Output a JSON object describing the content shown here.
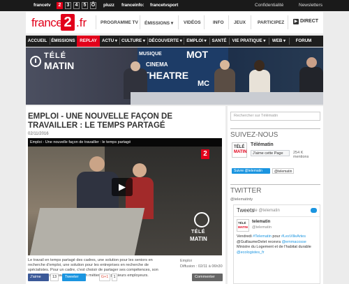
{
  "topbar": {
    "networks": [
      "francetv",
      "pluzz",
      "franceinfo:",
      "francetvsport"
    ],
    "channels": [
      "2",
      "3",
      "4",
      "5",
      "Ô"
    ],
    "right_links": [
      "Confidentialité",
      "Newsletters"
    ]
  },
  "header": {
    "logo_left": "france",
    "logo_num": "2",
    "logo_right": ".fr",
    "nav": [
      "PROGRAMME TV",
      "ÉMISSIONS ▾",
      "VIDÉOS",
      "INFO",
      "JEUX",
      "PARTICIPEZ"
    ],
    "direct": "DIRECT"
  },
  "section_nav": [
    "ACCUEIL",
    "ÉMISSIONS",
    "REPLAY",
    "ACTU ▾",
    "CULTURE ▾",
    "DÉCOUVERTE ▾",
    "EMPLOI ▾",
    "SANTÉ",
    "VIE PRATIQUE ▾",
    "WEB ▾",
    "FORUM"
  ],
  "banner": {
    "brand_top": "TÉLÉ",
    "brand_bottom": "MATIN",
    "studio_words": [
      "MUSIQUE",
      "CINEMA",
      "THEATRE",
      "MOT",
      "MC"
    ]
  },
  "article": {
    "title": "EMPLOI - UNE NOUVELLE FAÇON DE TRAVAILLER : LE TEMPS PARTAGÉ",
    "date": "02/11/2016",
    "video_title": "Emploi - Une nouvelle façon de travailler : le temps partagé",
    "video_brand_top": "TÉLÉ",
    "video_brand_bottom": "MATIN",
    "description": "Le travail en temps partagé des cadres, une solution pour les seniors en recherche d'emploi, une solution pour les entreprises en recherche de spécialistes. Pour un cadre, c'est choisir de partager ses compétences, son expérience, son savoir-faire et son métier entre plusieurs employeurs.",
    "meta_label": "Emploi",
    "meta_diffusion": "Diffusion : 02/11 à 06h30",
    "share": {
      "fb_label": "J'aime",
      "fb_count": "13",
      "tw_label": "Tweeter",
      "gplus_label": "G+1",
      "gplus_count": "1",
      "comment_label": "Commenter"
    }
  },
  "sidebar": {
    "search_placeholder": "Rechercher sur Télématin",
    "follow_heading": "SUIVEZ-NOUS",
    "fb_thumb_top": "TÉLÉ",
    "fb_thumb_bottom": "MATIN",
    "fb_page_name": "Télématin",
    "fb_like": "J'aime cette Page",
    "fb_count": "254 K mentions",
    "tw_follow": "Suivre @telematin",
    "tw_chip": "@telematin",
    "twitter_heading": "TWITTER",
    "tw_account": "@telematinty",
    "tweets_label": "Tweets",
    "tweets_by": "de @telematin",
    "tweet_name": "telematin",
    "tweet_handle": "@telematin",
    "tweet_text_1": "Vendredi ",
    "tweet_link_1": "#Telematin",
    "tweet_text_2": " pour ",
    "tweet_link_2": "#LesVilleArtes",
    "tweet_text_3": " @GuillaumeDelet recevra ",
    "tweet_link_3": "@emmacosse",
    "tweet_text_4": " Ministre du Logement et de l'habitat durable ",
    "tweet_link_4": "@ecologistes_fr"
  },
  "colors": {
    "brand_red": "#e2001a",
    "nav_dark": "#1e1e1e",
    "twitter_blue": "#1b95e0",
    "facebook_blue": "#3b5998"
  }
}
